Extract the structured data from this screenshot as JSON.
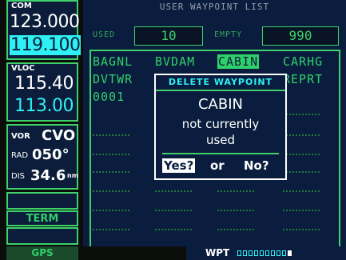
{
  "left": {
    "com": {
      "label": "COM",
      "active": "123.000",
      "standby": "119.100"
    },
    "vloc": {
      "label": "VLOC",
      "active": "115.40",
      "standby": "113.00"
    },
    "vor": {
      "label": "VOR",
      "ident": "CVO",
      "rad_label": "RAD",
      "rad_value": "050°",
      "dis_label": "DIS",
      "dis_value": "34.6",
      "dis_unit": "nm"
    },
    "term": "TERM"
  },
  "page": {
    "title": "USER WAYPOINT LIST",
    "used_label": "USED",
    "used_value": "10",
    "empty_label": "EMPTY",
    "empty_value": "990"
  },
  "waypoints": {
    "r0": [
      "BAGNL",
      "BVDAM",
      "CABIN",
      "CARHG"
    ],
    "r1": [
      "DVTWR",
      "",
      "",
      "REPRT"
    ],
    "r2": [
      "0001"
    ]
  },
  "dialog": {
    "header": "DELETE WAYPOINT",
    "name": "CABIN",
    "line2": "not currently",
    "line3": "used",
    "yes": "Yes?",
    "or": "or",
    "no": "No?"
  },
  "status": {
    "mode": "GPS",
    "page_group": "WPT",
    "page_count": 10,
    "page_active": 10
  }
}
